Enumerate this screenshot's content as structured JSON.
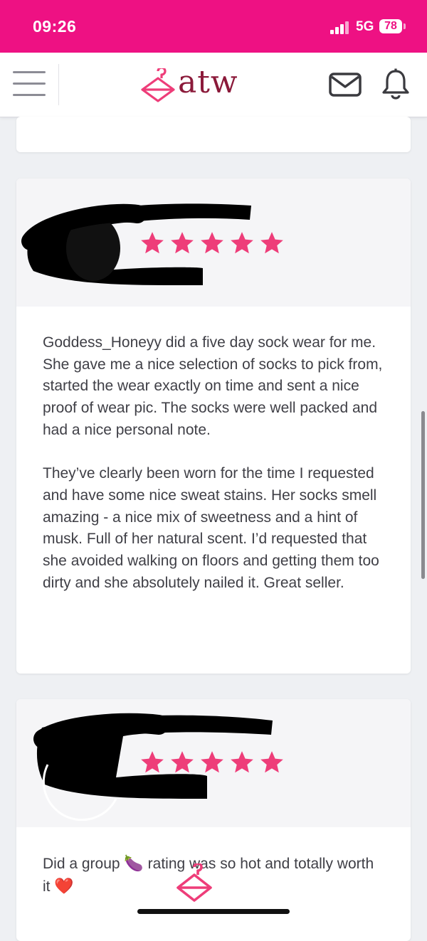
{
  "status_bar": {
    "time": "09:26",
    "network": "5G",
    "battery": "78"
  },
  "header": {
    "logo_text": "atw",
    "icons": [
      "menu-icon",
      "hanger-icon",
      "mail-icon",
      "bell-icon"
    ]
  },
  "colors": {
    "brand_pink": "#ee1183",
    "logo_maroon": "#8b1a3a",
    "star_pink": "#ee3d79"
  },
  "reviews": [
    {
      "rating": 5,
      "paragraphs": [
        "Goddess_Honeyy did a five day sock wear for me. She gave me a nice selection of socks to pick from, started the wear exactly on time and sent a nice proof of wear pic. The socks were well packed and had a nice personal note.",
        "They’ve clearly been worn for the time I requested and have some nice sweat stains. Her socks smell amazing - a nice mix of sweetness and a hint of musk. Full of her natural scent. I’d requested that she avoided walking on floors and getting them too dirty and she absolutely nailed it. Great seller."
      ]
    },
    {
      "rating": 5,
      "text_before": "Did a group ",
      "emoji_1": "🍆",
      "text_after": " rating was so hot and totally worth it ",
      "emoji_2": "❤️"
    }
  ]
}
